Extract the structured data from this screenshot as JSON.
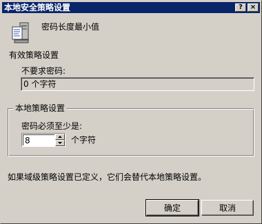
{
  "window": {
    "title": "本地安全策略设置",
    "help_label": "?",
    "close_label": "×"
  },
  "policy": {
    "icon": "policy-document-icon",
    "name": "密码长度最小值"
  },
  "effective": {
    "heading": "有效策略设置",
    "sublabel": "不要求密码:",
    "value": "0 个字符"
  },
  "local": {
    "group_label": "本地策略设置",
    "field_label": "密码必须至少是:",
    "value": "8",
    "unit": "个字符"
  },
  "note": "如果域级策略设置已定义，它们会替代本地策略设置。",
  "buttons": {
    "ok": "确定",
    "cancel": "取消"
  },
  "colors": {
    "titlebar": "#0a246a",
    "face": "#d4d0c8"
  }
}
